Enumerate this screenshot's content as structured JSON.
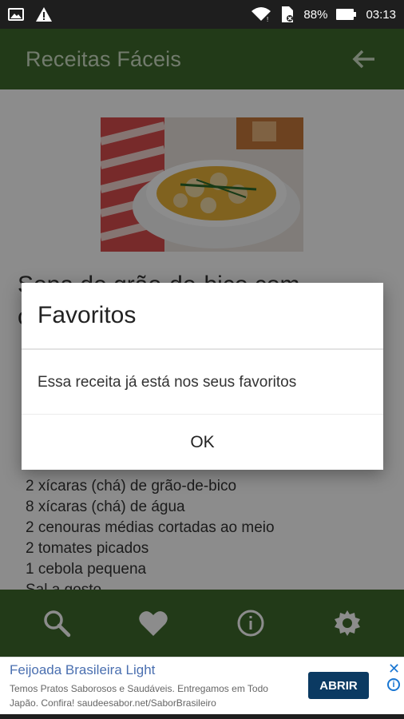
{
  "status_bar": {
    "battery_percent": "88%",
    "time": "03:13"
  },
  "app_bar": {
    "title": "Receitas Fáceis"
  },
  "recipe": {
    "title": "Sopa de grão-de-bico com cenoura e tomate",
    "ingredients": [
      "2 xícaras (chá) de grão-de-bico",
      "8 xícaras (chá) de água",
      "2 cenouras médias cortadas ao meio",
      "2 tomates picados",
      "1 cebola pequena",
      "Sal a gosto"
    ]
  },
  "dialog": {
    "title": "Favoritos",
    "message": "Essa receita já está nos seus favoritos",
    "ok_label": "OK"
  },
  "ad": {
    "headline": "Feijoada Brasileira Light",
    "body": "Temos Pratos Saborosos e Saudáveis. Entregamos em Todo Japão. Confira! saudeesabor.net/SaborBrasileiro",
    "cta": "ABRIR"
  },
  "colors": {
    "app_bar": "#3f6b2c",
    "title_text": "#cfe0c6",
    "status_bar": "#1e1e1e",
    "ad_cta": "#0b3a62"
  },
  "icons": [
    "image-icon",
    "warning-icon",
    "wifi-icon",
    "sim-icon",
    "battery-icon",
    "back-arrow-icon",
    "search-icon",
    "heart-icon",
    "info-icon",
    "settings-icon",
    "close-icon",
    "adchoices-icon"
  ]
}
